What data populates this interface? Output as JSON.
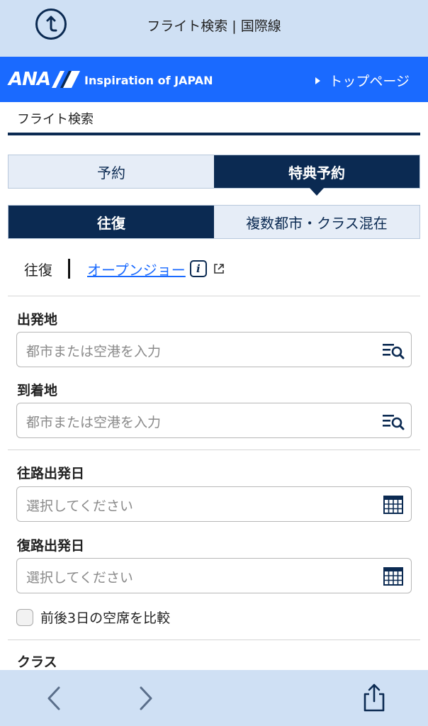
{
  "top_bar": {
    "title": "フライト検索 | 国際線"
  },
  "brand_bar": {
    "logo_text": "ANA",
    "tagline": "Inspiration of JAPAN",
    "top_page_link": "トップページ",
    "brand_color": "#1a6aff"
  },
  "breadcrumb": {
    "label": "フライト検索"
  },
  "booking_type_tabs": [
    {
      "label": "予約",
      "selected": false
    },
    {
      "label": "特典予約",
      "selected": true
    }
  ],
  "trip_type_tabs": [
    {
      "label": "往復",
      "selected": true
    },
    {
      "label": "複数都市・クラス混在",
      "selected": false
    }
  ],
  "trip_options": {
    "current": "往復",
    "open_jaw_link": "オープンジョー"
  },
  "origin": {
    "label": "出発地",
    "placeholder": "都市または空港を入力"
  },
  "destination": {
    "label": "到着地",
    "placeholder": "都市または空港を入力"
  },
  "outbound_date": {
    "label": "往路出発日",
    "placeholder": "選択してください"
  },
  "return_date": {
    "label": "復路出発日",
    "placeholder": "選択してください"
  },
  "compare_seats": {
    "label": "前後3日の空席を比較",
    "checked": false
  },
  "class_section": {
    "label": "クラス"
  },
  "icons": {
    "top_left": "update-circle-icon",
    "field_search": "list-search-icon",
    "calendar": "calendar-icon",
    "info": "info-icon",
    "external": "external-link-icon",
    "back": "chevron-left-icon",
    "forward": "chevron-right-icon",
    "share": "share-icon"
  },
  "colors": {
    "navy": "#0b2a52",
    "light_tab": "#e6edf7",
    "chrome_bar": "#cfe0f4"
  }
}
